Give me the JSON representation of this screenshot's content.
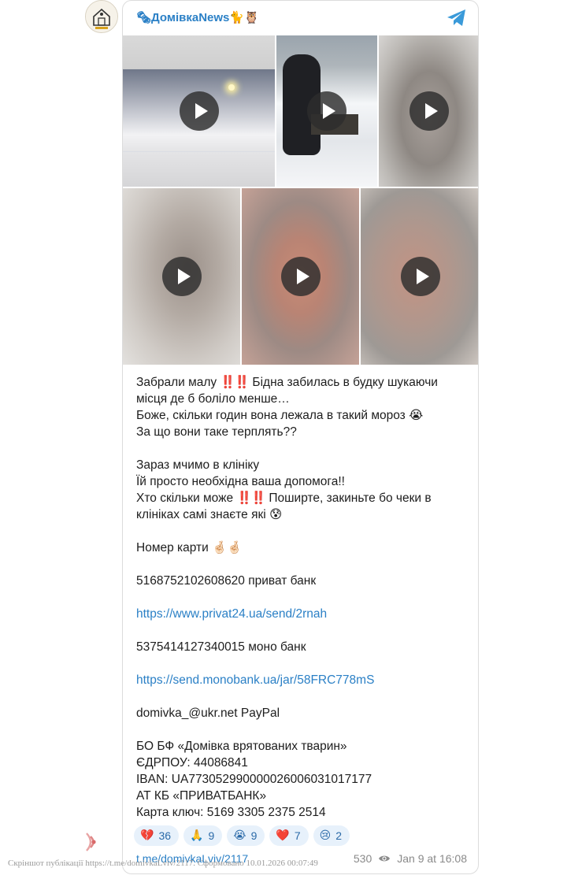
{
  "channel": {
    "name": "🗞ДомівкаNews🐈🦉",
    "logo_text": "ДОМІВКА"
  },
  "post": {
    "paragraphs": [
      [
        "Забрали малу ",
        "‼️‼️",
        " Бідна забилась в будку шукаючи місця де б боліло менше…"
      ],
      [
        "Боже, скільки годин вона лежала в такий мороз ",
        "😭"
      ],
      [
        "За що вони таке терплять??"
      ],
      [],
      [
        "Зараз мчимо в клініку"
      ],
      [
        "Їй просто необхідна ваша допомога!!"
      ],
      [
        "Хто скільки може ",
        "‼️‼️",
        " Поширте, закиньте бо чеки в клініках самі знаєте які ",
        "😰"
      ],
      [],
      [
        "Номер карти ",
        "🤞🏻🤞🏻"
      ],
      [],
      [
        "5168752102608620 приват банк"
      ],
      [],
      [
        "LINK:https://www.privat24.ua/send/2rnah"
      ],
      [],
      [
        "5375414127340015 моно банк"
      ],
      [],
      [
        "LINK:https://send.monobank.ua/jar/58FRC778mS"
      ],
      [],
      [
        "domivka_@ukr.net PayPal"
      ],
      [],
      [
        "БО БФ «Домівка врятованих тварин»"
      ],
      [
        "ЄДРПОУ: 44086841"
      ],
      [
        "IBAN: UA773052990000026006031017177"
      ],
      [
        "АТ КБ «ПРИВАТБАНК»"
      ],
      [
        "Карта ключ: 5169 3305 2375 2514"
      ]
    ]
  },
  "reactions": [
    {
      "emoji": "💔",
      "count": "36"
    },
    {
      "emoji": "🙏",
      "count": "9"
    },
    {
      "emoji": "😭",
      "count": "9"
    },
    {
      "emoji": "❤️",
      "count": "7"
    },
    {
      "emoji": "😢",
      "count": "2"
    }
  ],
  "footer": {
    "link": "t.me/domivkaLviv/2117",
    "views": "530",
    "date": "Jan 9 at 16:08"
  },
  "watermark": "Скріншот публікації https://t.me/domivkaLviv/2117. Сформовано 10.01.2026 00:07:49",
  "colors": {
    "accent": "#2b80c6",
    "reaction_bg": "#e7f1fb"
  },
  "icons": {
    "telegram": "telegram-icon",
    "play": "play-icon",
    "views": "eye-icon",
    "signal": "signal-icon"
  }
}
